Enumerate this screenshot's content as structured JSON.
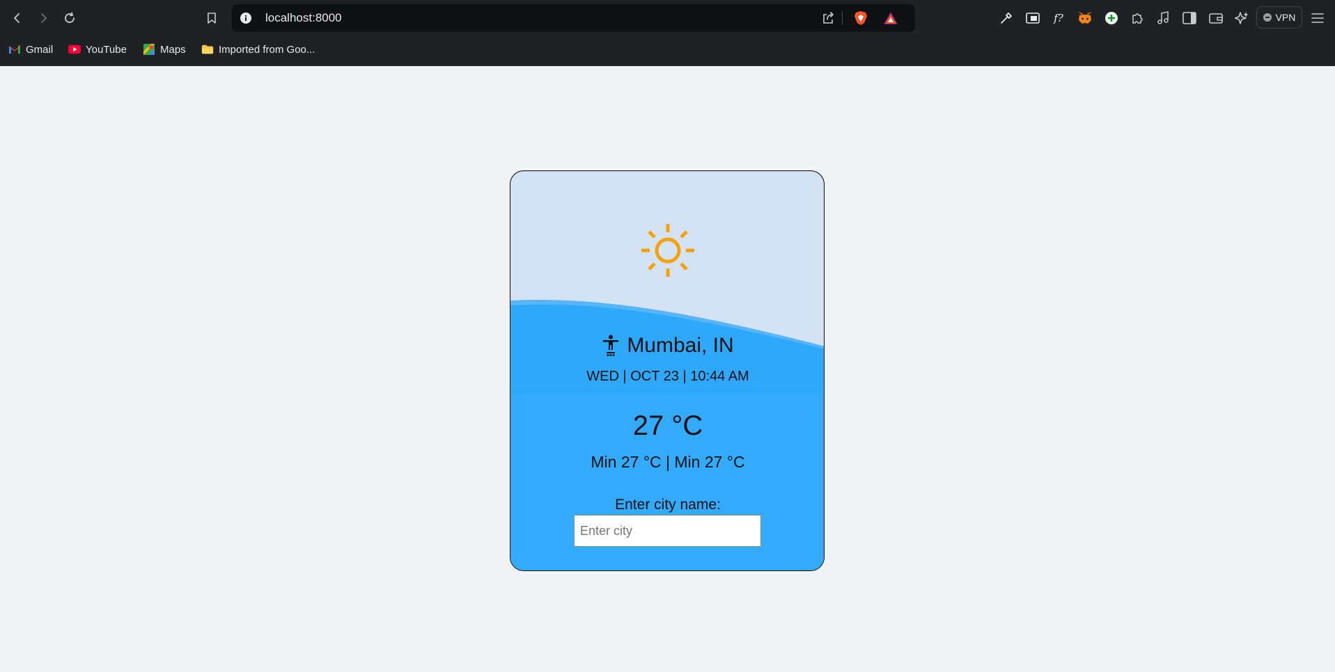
{
  "browser": {
    "address": "localhost:8000",
    "vpn_label": "VPN",
    "bookmarks": [
      {
        "label": "Gmail",
        "icon": "gmail-icon"
      },
      {
        "label": "YouTube",
        "icon": "youtube-icon"
      },
      {
        "label": "Maps",
        "icon": "maps-icon"
      },
      {
        "label": "Imported from Goo...",
        "icon": "folder-icon"
      }
    ],
    "colors": {
      "chrome": "#1f2125",
      "address_bar": "#0f1012"
    }
  },
  "weather": {
    "icon": "sun-icon",
    "city": "Mumbai, IN",
    "datetime": "WED | OCT 23 | 10:44 AM",
    "temperature": "27 °C",
    "min_max": "Min 27 °C | Min 27 °C",
    "input_label": "Enter city name:",
    "input_placeholder": "Enter city",
    "input_value": "",
    "colors": {
      "sky": "#d3e3f4",
      "wave": "#2ea8fb",
      "sun": "#f5a20a"
    }
  }
}
